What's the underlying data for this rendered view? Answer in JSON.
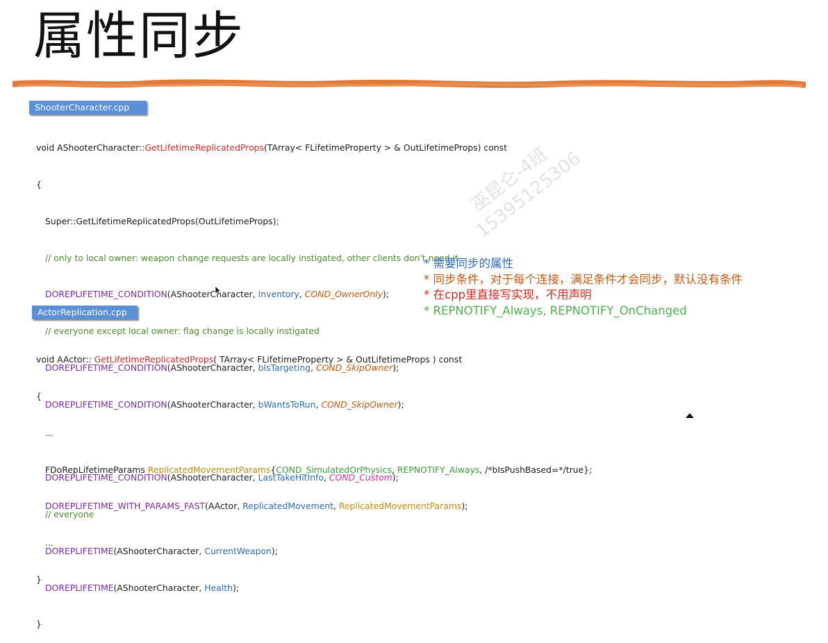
{
  "slide": {
    "title": "属性同步"
  },
  "tabs": {
    "shooter": "ShooterCharacter.cpp",
    "actor": "ActorReplication.cpp"
  },
  "code1": {
    "l1a": "void AShooterCharacter::",
    "l1b": "GetLifetimeReplicatedProps",
    "l1c": "(TArray< FLifetimeProperty > & OutLifetimeProps) const",
    "l2": "{",
    "l3": "Super::GetLifetimeReplicatedProps(OutLifetimeProps);",
    "l4": "// only to local owner: weapon change requests are locally instigated, other clients don't need it",
    "l5a": "DOREPLIFETIME_CONDITION",
    "l5b": "(AShooterCharacter, ",
    "l5c": "Inventory",
    "l5d": ", ",
    "l5e": "COND_OwnerOnly",
    "l5f": ");",
    "l6": "// everyone except local owner: flag change is locally instigated",
    "l7a": "DOREPLIFETIME_CONDITION",
    "l7b": "(AShooterCharacter, ",
    "l7c": "bIsTargeting",
    "l7d": ", ",
    "l7e": "COND_SkipOwner",
    "l7f": ");",
    "l8a": "DOREPLIFETIME_CONDITION",
    "l8b": "(AShooterCharacter, ",
    "l8c": "bWantsToRun",
    "l8d": ", ",
    "l8e": "COND_SkipOwner",
    "l8f": ");",
    "l10a": "DOREPLIFETIME_CONDITION",
    "l10b": "(AShooterCharacter, ",
    "l10c": "LastTakeHitInfo",
    "l10d": ", ",
    "l10e": "COND_Custom",
    "l10f": ");",
    "l11": "// everyone",
    "l12a": "DOREPLIFETIME",
    "l12b": "(AShooterCharacter, ",
    "l12c": "CurrentWeapon",
    "l12d": ");",
    "l13a": "DOREPLIFETIME",
    "l13b": "(AShooterCharacter, ",
    "l13c": "Health",
    "l13d": ");",
    "l14": "}"
  },
  "code2": {
    "l1a": "void AActor:: ",
    "l1b": "GetLifetimeReplicatedProps",
    "l1c": "( TArray< FLifetimeProperty > & OutLifetimeProps ) const",
    "l2": "{",
    "l3": "...",
    "l4a": "FDoRepLifetimeParams ",
    "l4b": "ReplicatedMovementParams",
    "l4c": "{",
    "l4d": "COND_SimulatedOrPhysics",
    "l4e": ", ",
    "l4f": "REPNOTIFY_Always",
    "l4g": ", /*bIsPushBased=*/true};",
    "l5a": "DOREPLIFETIME_WITH_PARAMS_FAST",
    "l5b": "(AActor, ",
    "l5c": "ReplicatedMovement",
    "l5d": ", ",
    "l5e": "ReplicatedMovementParams",
    "l5f": ");",
    "l6": "...",
    "l7": "}"
  },
  "notes": {
    "n1": "* 需要同步的属性",
    "n2": "* 同步条件，对于每个连接，满足条件才会同步，默认没有条件",
    "n3a": "* 在",
    "n3b": "cpp",
    "n3c": "里直接写实现，不用声明",
    "n4": "* REPNOTIFY_Always, REPNOTIFY_OnChanged"
  },
  "watermark": {
    "name": "巫昆仑-4班",
    "phone": "15395125306"
  },
  "colors": {
    "brush": "#e07a3a",
    "tab": "#5b8fd6",
    "function_red": "#d32c2c",
    "macro_purple": "#7c2aa3",
    "member_blue": "#2e6bb8",
    "condition_orange": "#c45a12",
    "comment_green": "#4d8a2e"
  },
  "icons": {
    "cursor": "mouse-pointer-icon",
    "corner": "triangle-up-icon"
  }
}
